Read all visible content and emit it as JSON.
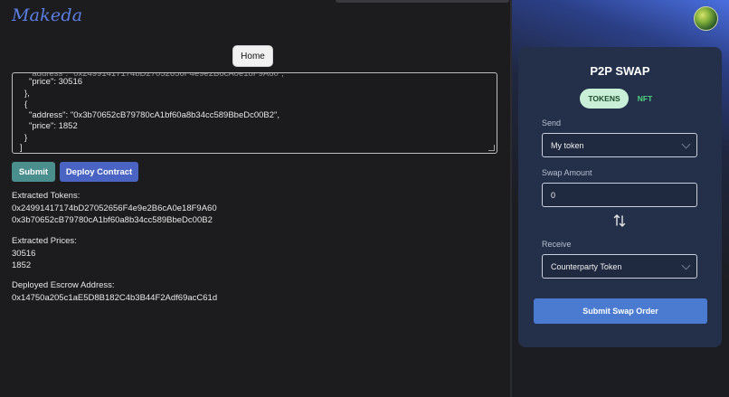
{
  "app": {
    "logo_text": "Makeda"
  },
  "nav": {
    "home_label": "Home"
  },
  "json_editor": {
    "lines": [
      "\"price\": 30516",
      "},",
      "{",
      "\"address\": \"0x3b70652cB79780cA1bf60a8b34cc589BbeDc00B2\",",
      "\"price\": 1852",
      "}",
      "]"
    ]
  },
  "actions": {
    "submit_label": "Submit",
    "deploy_label": "Deploy Contract"
  },
  "results": {
    "tokens_heading": "Extracted Tokens:",
    "tokens": [
      "0x24991417174bD27052656F4e9e2B6cA0e18F9A60",
      "0x3b70652cB79780cA1bf60a8b34cc589BbeDc00B2"
    ],
    "prices_heading": "Extracted Prices:",
    "prices": [
      "30516",
      "1852"
    ],
    "escrow_heading": "Deployed Escrow Address:",
    "escrow_address": "0x14750a205c1aE5D8B182C4b3B44F2Adf69acC61d"
  },
  "swap": {
    "title": "P2P SWAP",
    "tabs": [
      {
        "label": "TOKENS",
        "active": true
      },
      {
        "label": "NFT",
        "active": false
      }
    ],
    "send_label": "Send",
    "send_value": "My token",
    "amount_label": "Swap Amount",
    "amount_value": "0",
    "receive_label": "Receive",
    "receive_value": "Counterparty Token",
    "submit_label": "Submit Swap Order"
  },
  "icons": {
    "swap": "swap-arrows-icon",
    "avatar": "user-avatar",
    "chevron": "chevron-down-icon"
  },
  "colors": {
    "accent_blue": "#4a7bd0",
    "tab_active_bg": "#c9f0d6",
    "nft_green": "#4ed07f",
    "submit_teal": "#4a8f8d",
    "deploy_blue": "#4a64c4"
  }
}
